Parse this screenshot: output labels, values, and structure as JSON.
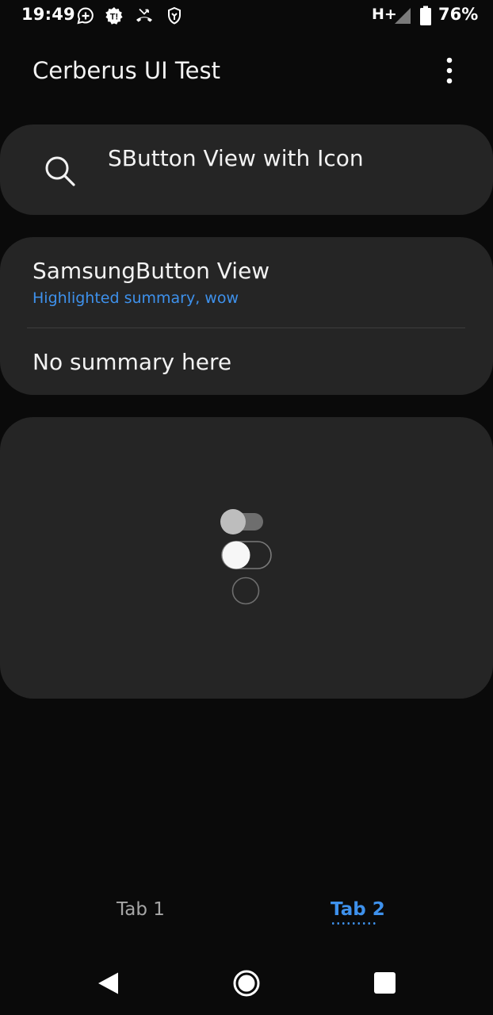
{
  "status_bar": {
    "time": "19:49",
    "network": "H+",
    "battery_percent": "76%",
    "icons": [
      "chat-plus-icon",
      "settings-notification-icon",
      "missed-call-icon",
      "shield-icon",
      "signal-icon",
      "battery-icon"
    ]
  },
  "app_bar": {
    "title": "Cerberus UI Test",
    "menu_icon": "more-vert-icon"
  },
  "search_card": {
    "text": "SButton View with Icon",
    "icon": "search-icon"
  },
  "list_card": {
    "items": [
      {
        "title": "SamsungButton View",
        "summary": "Highlighted summary, wow"
      },
      {
        "title": "No summary here"
      }
    ]
  },
  "controls_card": {
    "toggle_1": {
      "state": "off",
      "style": "filled"
    },
    "toggle_2": {
      "state": "off",
      "style": "outlined"
    },
    "radio": {
      "checked": false
    }
  },
  "tabs": {
    "items": [
      {
        "label": "Tab 1",
        "selected": false
      },
      {
        "label": "Tab 2",
        "selected": true
      }
    ]
  },
  "nav_bar": {
    "buttons": [
      "back-icon",
      "home-icon",
      "recents-icon"
    ]
  },
  "colors": {
    "background": "#0a0a0a",
    "card": "#252525",
    "accent": "#3e91ec",
    "text_primary": "#f2f2f2",
    "text_secondary": "#a6a6a6"
  }
}
